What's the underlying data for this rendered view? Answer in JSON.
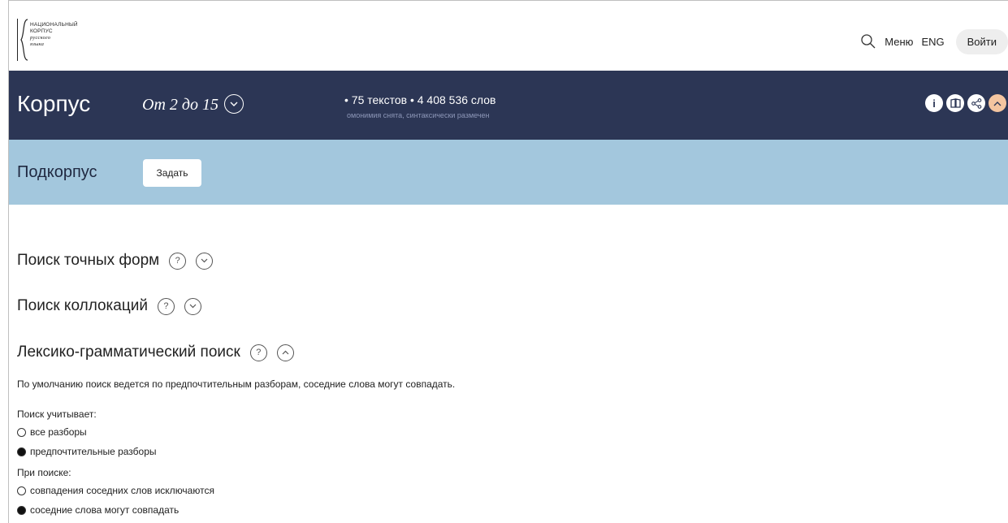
{
  "header": {
    "logo_lines": [
      "НАЦИОНАЛЬНЫЙ",
      "КОРПУС",
      "русского",
      "языка"
    ],
    "search_icon": "search-icon",
    "menu_label": "Меню",
    "lang_label": "ENG",
    "login_label": "Войти"
  },
  "corpus": {
    "title": "Корпус",
    "range": "От 2 до 15",
    "stats": "• 75 текстов  • 4 408 536 слов",
    "stats_sub": "омонимия снята, синтаксически размечен",
    "icons": [
      "info-icon",
      "book-icon",
      "share-icon",
      "chevron-up-icon"
    ],
    "info_glyph": "i"
  },
  "subcorpus": {
    "title": "Подкорпус",
    "button_label": "Задать"
  },
  "sections": {
    "exact_forms": "Поиск точных форм",
    "collocations": "Поиск коллокаций",
    "lexgram": "Лексико-грамматический поиск",
    "help_glyph": "?"
  },
  "lexgram": {
    "note": "По умолчанию поиск ведется по предпочтительным разборам, соседние слова могут совпадать.",
    "group1_label": "Поиск учитывает:",
    "group1_options": [
      "все разборы",
      "предпочтительные разборы"
    ],
    "group1_selected": 1,
    "group2_label": "При поиске:",
    "group2_options": [
      "совпадения соседних слов исключаются",
      "соседние слова могут совпадать"
    ],
    "group2_selected": 1
  }
}
